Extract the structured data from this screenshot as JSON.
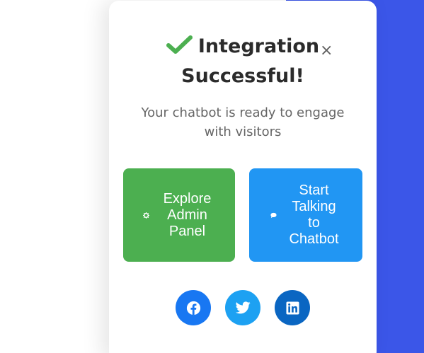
{
  "colors": {
    "background_accent": "#3b56e8",
    "success_check": "#4caf50",
    "admin_button": "#4caf50",
    "chat_button": "#2196f3",
    "facebook": "#1877f2",
    "twitter": "#1da1f2",
    "linkedin": "#0a66c2"
  },
  "modal": {
    "title": "Integration Successful!",
    "title_icon": "check-icon",
    "close_label": "×",
    "subtitle": "Your chatbot is ready to engage with visitors"
  },
  "actions": {
    "admin": {
      "label": "Explore Admin Panel",
      "icon": "gear-icon"
    },
    "chat": {
      "label": "Start Talking to Chatbot",
      "icon": "chat-bubble-icon"
    }
  },
  "social": [
    {
      "network": "Facebook",
      "icon": "facebook-icon"
    },
    {
      "network": "Twitter",
      "icon": "twitter-icon"
    },
    {
      "network": "LinkedIn",
      "icon": "linkedin-icon"
    }
  ]
}
